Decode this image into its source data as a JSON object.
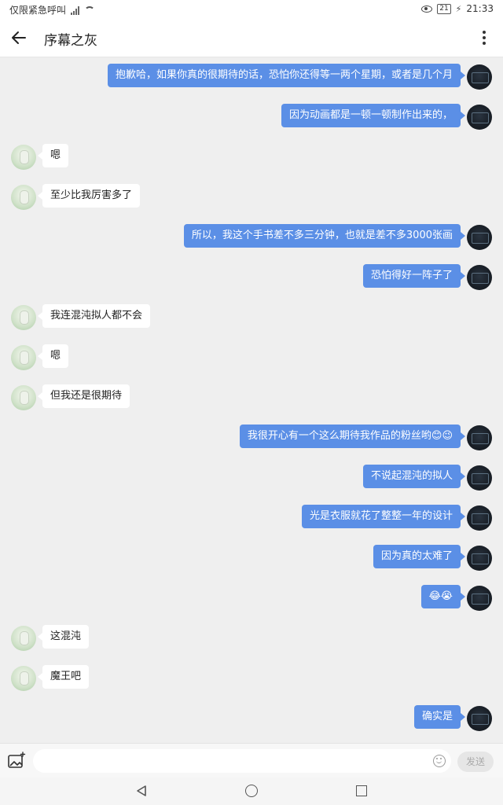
{
  "status_bar": {
    "carrier": "仅限紧急呼叫",
    "battery": "21",
    "time": "21:33"
  },
  "header": {
    "title": "序幕之灰"
  },
  "messages": [
    {
      "side": "out",
      "text": "抱歉哈，如果你真的很期待的话，恐怕你还得等一两个星期，或者是几个月"
    },
    {
      "side": "out",
      "text": "因为动画都是一顿一顿制作出来的，"
    },
    {
      "side": "in",
      "text": "嗯"
    },
    {
      "side": "in",
      "text": "至少比我厉害多了"
    },
    {
      "side": "out",
      "text": "所以，我这个手书差不多三分钟，也就是差不多3000张画"
    },
    {
      "side": "out",
      "text": "恐怕得好一阵子了"
    },
    {
      "side": "in",
      "text": "我连混沌拟人都不会"
    },
    {
      "side": "in",
      "text": "嗯"
    },
    {
      "side": "in",
      "text": "但我还是很期待"
    },
    {
      "side": "out",
      "text": "我很开心有一个这么期待我作品的粉丝哟😊😉"
    },
    {
      "side": "out",
      "text": "不说起混沌的拟人"
    },
    {
      "side": "out",
      "text": "光是衣服就花了整整一年的设计"
    },
    {
      "side": "out",
      "text": "因为真的太难了"
    },
    {
      "side": "out",
      "text": "😂😭"
    },
    {
      "side": "in",
      "text": "这混沌"
    },
    {
      "side": "in",
      "text": "魔王吧"
    },
    {
      "side": "out",
      "text": "确实是"
    }
  ],
  "input": {
    "value": "",
    "send_label": "发送"
  },
  "icons": {
    "back": "arrow-left-icon",
    "more": "more-vertical-icon",
    "image": "image-sparkle-icon",
    "emoji": "smiley-icon",
    "nav_back": "triangle-back-icon",
    "nav_home": "circle-home-icon",
    "nav_recent": "square-recent-icon"
  },
  "colors": {
    "outgoing_bubble": "#5b8fe6",
    "incoming_bubble": "#ffffff",
    "chat_background": "#efefef"
  }
}
